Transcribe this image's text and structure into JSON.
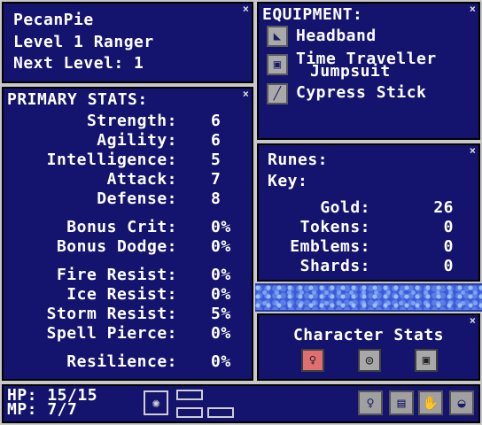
{
  "character": {
    "name": "PecanPie",
    "level_line": "Level 1 Ranger",
    "next_level": "Next Level: 1"
  },
  "stats": {
    "title": "PRIMARY STATS:",
    "rows": [
      {
        "label": "Strength:",
        "value": "6"
      },
      {
        "label": "Agility:",
        "value": "6"
      },
      {
        "label": "Intelligence:",
        "value": "5"
      },
      {
        "label": "Attack:",
        "value": "7"
      },
      {
        "label": "Defense:",
        "value": "8"
      },
      {
        "label": "Bonus Crit:",
        "value": "0%"
      },
      {
        "label": "Bonus Dodge:",
        "value": "0%"
      },
      {
        "label": "Fire Resist:",
        "value": "0%"
      },
      {
        "label": "Ice Resist:",
        "value": "0%"
      },
      {
        "label": "Storm Resist:",
        "value": "5%"
      },
      {
        "label": "Spell Pierce:",
        "value": "0%"
      },
      {
        "label": "Resilience:",
        "value": "0%"
      }
    ]
  },
  "equipment": {
    "title": "EQUIPMENT:",
    "items": [
      {
        "line1": "Headband",
        "line2": "",
        "icon": "headband-icon"
      },
      {
        "line1": "Time Traveller",
        "line2": "Jumpsuit",
        "icon": "jumpsuit-icon"
      },
      {
        "line1": "Cypress Stick",
        "line2": "",
        "icon": "staff-icon"
      }
    ]
  },
  "currency": {
    "runes_label": "Runes:",
    "key_label": "Key:",
    "rows": [
      {
        "label": "Gold:",
        "value": "26"
      },
      {
        "label": "Tokens:",
        "value": "0"
      },
      {
        "label": "Emblems:",
        "value": "0"
      },
      {
        "label": "Shards:",
        "value": "0"
      }
    ]
  },
  "char_stats": {
    "title": "Character Stats"
  },
  "hud": {
    "hp": "HP: 15/15",
    "mp": "MP:  7/7"
  },
  "colors": {
    "panel": "#14146e",
    "border": "#c8c8c8",
    "active_tab": "#e07070",
    "water": "#3c5ad8"
  },
  "close_glyph": "×"
}
